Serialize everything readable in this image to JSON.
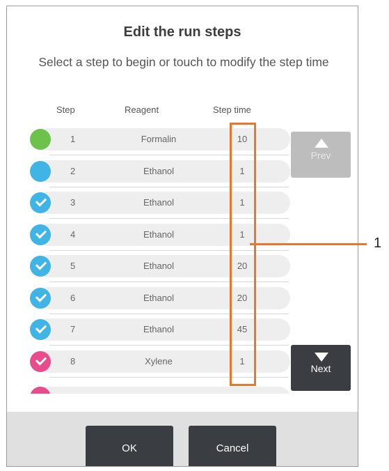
{
  "dialog": {
    "title": "Edit the run steps",
    "subtitle": "Select a step to begin or touch to modify the step time"
  },
  "table": {
    "headers": {
      "step": "Step",
      "reagent": "Reagent",
      "time": "Step time"
    },
    "rows": [
      {
        "step": "1",
        "reagent": "Formalin",
        "time": "10",
        "status": "green",
        "checked": false
      },
      {
        "step": "2",
        "reagent": "Ethanol",
        "time": "1",
        "status": "blue",
        "checked": false
      },
      {
        "step": "3",
        "reagent": "Ethanol",
        "time": "1",
        "status": "blue",
        "checked": true
      },
      {
        "step": "4",
        "reagent": "Ethanol",
        "time": "1",
        "status": "blue",
        "checked": true
      },
      {
        "step": "5",
        "reagent": "Ethanol",
        "time": "20",
        "status": "blue",
        "checked": true
      },
      {
        "step": "6",
        "reagent": "Ethanol",
        "time": "20",
        "status": "blue",
        "checked": true
      },
      {
        "step": "7",
        "reagent": "Ethanol",
        "time": "45",
        "status": "blue",
        "checked": true
      },
      {
        "step": "8",
        "reagent": "Xylene",
        "time": "1",
        "status": "pink",
        "checked": true
      }
    ],
    "partial_row_status": "pink"
  },
  "side_buttons": {
    "prev": "Prev",
    "next": "Next"
  },
  "footer": {
    "ok": "OK",
    "cancel": "Cancel"
  },
  "annotation": {
    "callout_number": "1"
  },
  "colors": {
    "green": "#6cc24a",
    "blue": "#3fb4e5",
    "pink": "#e84c8c",
    "highlight": "#e8762b",
    "button_dark": "#3a3d41",
    "button_disabled": "#bdbdbd"
  }
}
